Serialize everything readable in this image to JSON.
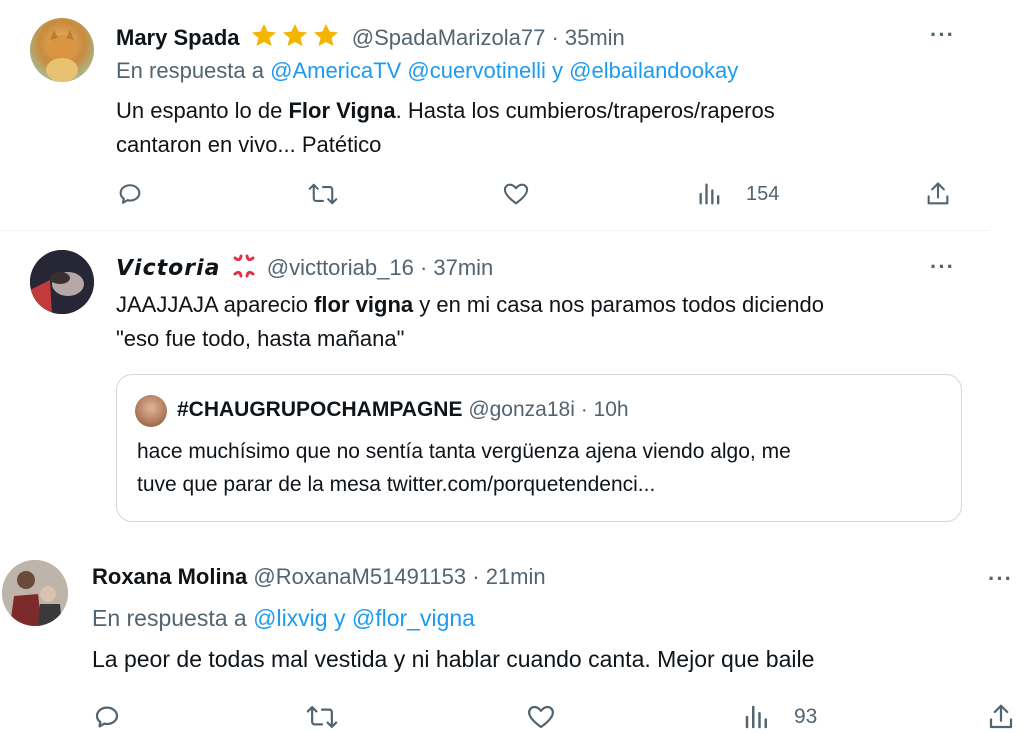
{
  "tweet1": {
    "name": "Mary Spada",
    "handle": "@SpadaMarizola77",
    "time": "· 35min",
    "reply_prefix": "En respuesta a",
    "reply_to_1": "@AmericaTV",
    "reply_to_2": "@cuervotinelli",
    "reply_and": "y",
    "reply_to_3": "@elbailandookay",
    "text_before": "Un espanto lo de ",
    "text_bold": "Flor Vigna",
    "text_after_line1": ". Hasta los cumbieros/traperos/raperos",
    "text_line2": "cantaron en vivo... Patético",
    "views": "154",
    "more": "···",
    "badge_icons": [
      "star-icon",
      "star-icon",
      "star-icon"
    ]
  },
  "tweet2": {
    "name": "𝙑𝙞𝙘𝙩𝙤𝙧𝙞𝙖",
    "handle": "@victtoriab_16",
    "time": "· 37min",
    "text_before": "JAAJJAJA aparecio ",
    "text_bold": "flor vigna",
    "text_after_line1": " y en mi casa nos paramos todos diciendo",
    "text_line2": "\"eso fue todo, hasta mañana\"",
    "more": "···",
    "badge_icon": "anger-icon",
    "quote": {
      "name": "#CHAUGRUPOCHAMPAGNE",
      "handle": "@gonza18i",
      "time": "· 10h",
      "text_line1": "hace muchísimo que no sentía tanta vergüenza ajena viendo algo, me",
      "text_line2": "tuve que parar de la mesa twitter.com/porquetendenci..."
    }
  },
  "tweet3": {
    "name": "Roxana Molina",
    "handle": "@RoxanaM51491153",
    "time": "· 21min",
    "reply_prefix": "En respuesta a",
    "reply_to_1": "@lixvig",
    "reply_and": "y",
    "reply_to_2": "@flor_vigna",
    "text": "La peor de todas mal vestida y ni hablar cuando canta. Mejor que baile",
    "views": "93",
    "more": "···"
  },
  "colors": {
    "text": "#0f1419",
    "muted": "#536471",
    "link": "#1d9bf0",
    "star": "#f4b400",
    "border": "#cfd9de"
  }
}
